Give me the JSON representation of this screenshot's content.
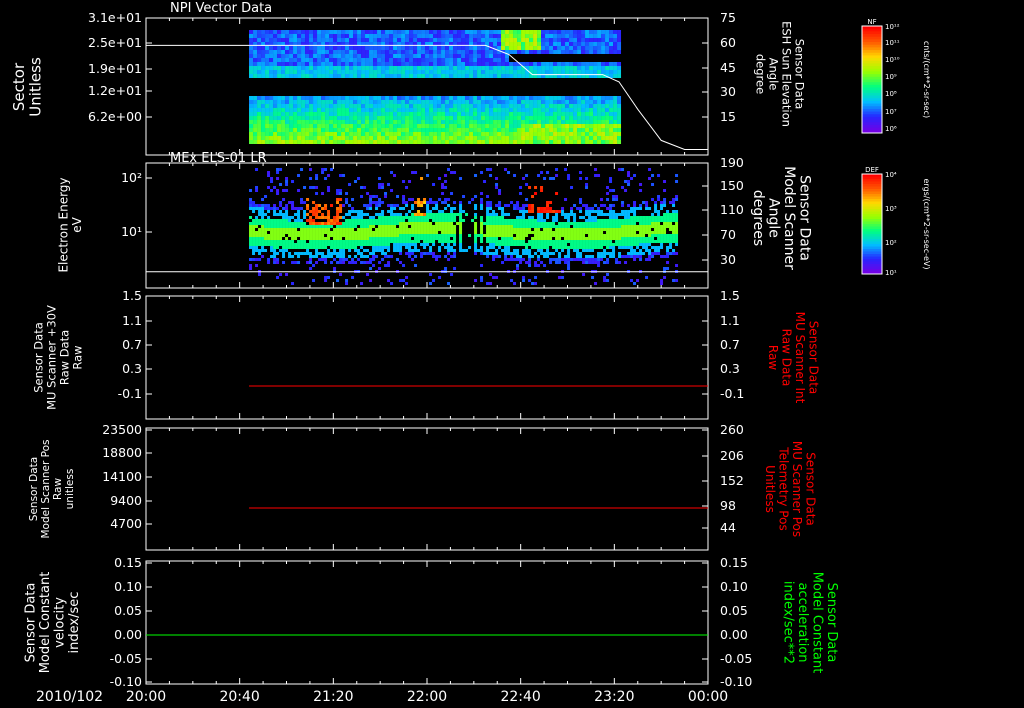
{
  "colors": {
    "background": "#000000",
    "foreground": "#ffffff",
    "red_trace": "#ff0000",
    "green_trace": "#00ff00"
  },
  "date_label": "2010/102",
  "time_ticks": [
    "20:00",
    "20:40",
    "21:20",
    "22:00",
    "22:40",
    "23:20",
    "00:00"
  ],
  "colorbars": [
    {
      "label": "NF",
      "units": "cnts/(cm**2-sr-sec)",
      "ticks": [
        "10¹²",
        "10¹¹",
        "10¹⁰",
        "10⁹",
        "10⁸",
        "10⁷",
        "10⁶"
      ]
    },
    {
      "label": "DEF",
      "units": "ergs/(cm**2-sr-sec-eV)",
      "ticks": [
        "10⁴",
        "10³",
        "10²",
        "10¹"
      ]
    }
  ],
  "chart_data": [
    {
      "type": "heatmap",
      "title": "NPI Vector Data",
      "ylabel": [
        "Sector",
        "Unitless"
      ],
      "y_ticks": [
        "3.1e+01",
        "2.5e+01",
        "1.9e+01",
        "1.2e+01",
        "6.2e+00"
      ],
      "ylim": [
        0,
        31
      ],
      "right_ylabel": [
        "Sensor Data",
        "ESH Sun Elevation",
        "Angle",
        "degree"
      ],
      "right_ticks": [
        "75",
        "60",
        "45",
        "30",
        "15"
      ],
      "right_ylim": [
        0,
        75
      ],
      "overlay_line": {
        "name": "ESH Sun Elevation Angle",
        "x": [
          "20:00",
          "22:25",
          "22:35",
          "22:45",
          "23:00",
          "23:15",
          "23:22",
          "23:30",
          "23:40",
          "23:50",
          "00:00"
        ],
        "y": [
          60,
          60,
          55,
          44,
          44,
          44,
          40,
          25,
          8,
          3,
          3
        ]
      }
    },
    {
      "type": "heatmap",
      "title": "MEx ELS-01 LR",
      "ylabel": [
        "Electron Energy",
        "eV"
      ],
      "y_ticks": [
        "10²",
        "10¹"
      ],
      "yscale": "log",
      "right_ylabel": [
        "Sensor Data",
        "Model Scanner",
        "Angle",
        "degrees"
      ],
      "right_ticks": [
        "190",
        "150",
        "110",
        "70",
        "30"
      ],
      "right_ylim": [
        0,
        190
      ],
      "overlay_line": {
        "name": "Model Scanner Angle",
        "x": [
          "20:00",
          "00:00"
        ],
        "y": [
          14,
          14
        ]
      }
    },
    {
      "type": "line",
      "ylabel": [
        "Sensor Data",
        "MU Scanner +30V",
        "Raw Data",
        "Raw"
      ],
      "y_ticks": [
        "1.5",
        "1.1",
        "0.7",
        "0.3",
        "-0.1"
      ],
      "ylim": [
        -0.4,
        1.5
      ],
      "right_ylabel": [
        "Sensor Data",
        "MU Scanner Int",
        "Raw Data",
        "Raw"
      ],
      "right_ticks": [
        "1.5",
        "1.1",
        "0.7",
        "0.3",
        "-0.1"
      ],
      "series": [
        {
          "x": [
            "20:44",
            "00:00"
          ],
          "y": [
            0,
            0
          ]
        }
      ]
    },
    {
      "type": "line",
      "ylabel": [
        "Sensor Data",
        "Model Scanner Pos",
        "Raw",
        "unitless"
      ],
      "y_ticks": [
        "23500",
        "18800",
        "14100",
        "9400",
        "4700"
      ],
      "ylim": [
        0,
        23500
      ],
      "right_ylabel": [
        "Sensor Data",
        "MU Scanner Pos",
        "Telemetry Pos",
        "Unitless"
      ],
      "right_ticks": [
        "260",
        "206",
        "152",
        "98",
        "44"
      ],
      "right_ylim": [
        0,
        260
      ],
      "series": [
        {
          "x": [
            "20:44",
            "00:00"
          ],
          "y": [
            85,
            85
          ]
        }
      ]
    },
    {
      "type": "line",
      "ylabel": [
        "Sensor Data",
        "Model Constant",
        "velocity",
        "index/sec"
      ],
      "y_ticks": [
        "0.15",
        "0.10",
        "0.05",
        "0.00",
        "-0.05",
        "-0.10"
      ],
      "ylim": [
        -0.1,
        0.15
      ],
      "right_ylabel": [
        "Sensor Data",
        "Model Constant",
        "acceleration",
        "index/sec**2"
      ],
      "right_ticks": [
        "0.15",
        "0.10",
        "0.05",
        "0.00",
        "-0.05",
        "-0.10"
      ],
      "series": [
        {
          "x": [
            "20:00",
            "00:00"
          ],
          "y": [
            0,
            0
          ]
        }
      ]
    }
  ]
}
